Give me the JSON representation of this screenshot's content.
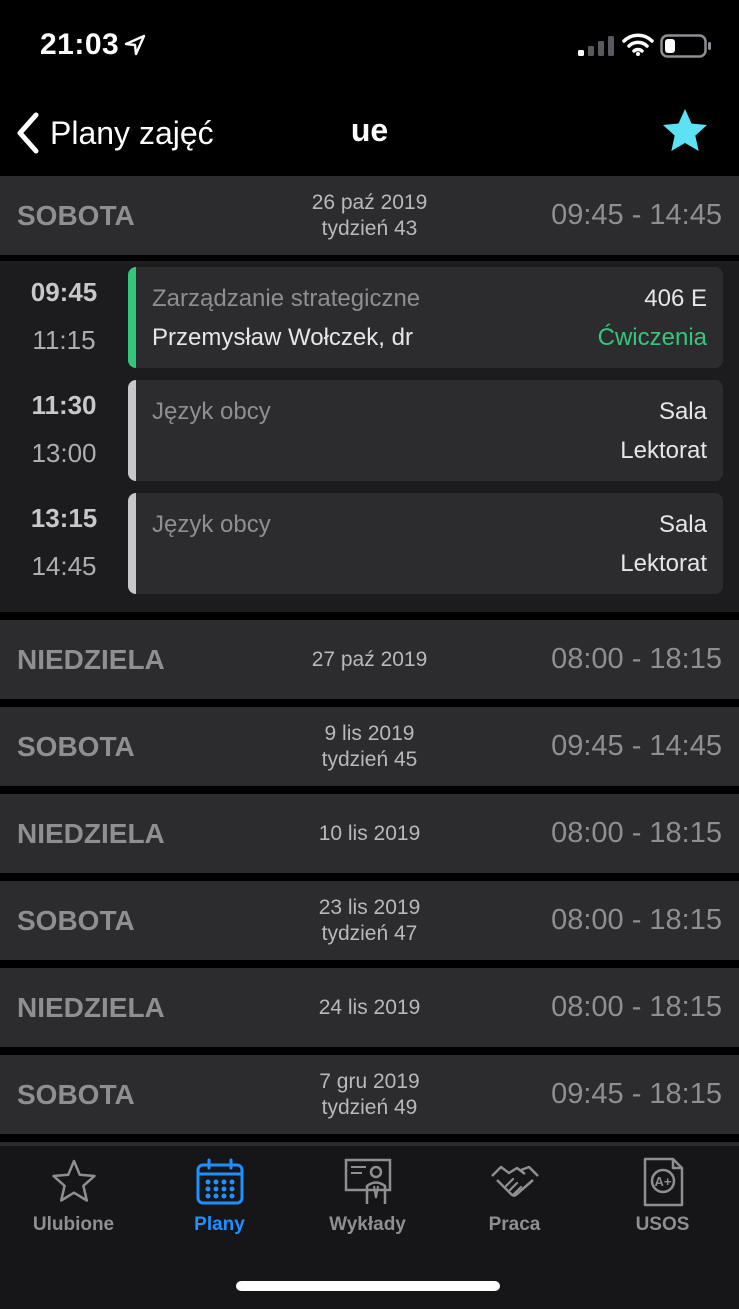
{
  "status_bar": {
    "time": "21:03",
    "icons": [
      "location-arrow-icon",
      "cellular-signal-icon",
      "wifi-icon",
      "battery-icon"
    ]
  },
  "nav": {
    "back_label": "Plany zajęć",
    "title": "ue",
    "favorite_icon": "star-filled-icon",
    "favorite_color": "#5ce1f5"
  },
  "days": [
    {
      "name": "SOBOTA",
      "date": "26 paź 2019",
      "week": "tydzień 43",
      "hours": "09:45 - 14:45",
      "lessons": [
        {
          "start": "09:45",
          "end": "11:15",
          "subject": "Zarządzanie strategiczne",
          "teacher": "Przemysław Wołczek, dr",
          "room": "406 E",
          "type": "Ćwiczenia",
          "type_color": "#34c77b",
          "bar_color": "#34c77b"
        },
        {
          "start": "11:30",
          "end": "13:00",
          "subject": "Język obcy",
          "teacher": "",
          "room": "Sala",
          "type": "Lektorat",
          "type_color": "#e5e5ea",
          "bar_color": "#c7c7cc"
        },
        {
          "start": "13:15",
          "end": "14:45",
          "subject": "Język obcy",
          "teacher": "",
          "room": "Sala",
          "type": "Lektorat",
          "type_color": "#e5e5ea",
          "bar_color": "#c7c7cc"
        }
      ]
    },
    {
      "name": "NIEDZIELA",
      "date": "27 paź 2019",
      "week": "",
      "hours": "08:00 - 18:15",
      "lessons": []
    },
    {
      "name": "SOBOTA",
      "date": "9 lis 2019",
      "week": "tydzień 45",
      "hours": "09:45 - 14:45",
      "lessons": []
    },
    {
      "name": "NIEDZIELA",
      "date": "10 lis 2019",
      "week": "",
      "hours": "08:00 - 18:15",
      "lessons": []
    },
    {
      "name": "SOBOTA",
      "date": "23 lis 2019",
      "week": "tydzień 47",
      "hours": "08:00 - 18:15",
      "lessons": []
    },
    {
      "name": "NIEDZIELA",
      "date": "24 lis 2019",
      "week": "",
      "hours": "08:00 - 18:15",
      "lessons": []
    },
    {
      "name": "SOBOTA",
      "date": "7 gru 2019",
      "week": "tydzień 49",
      "hours": "09:45 - 18:15",
      "lessons": []
    },
    {
      "name": "",
      "date": "",
      "week": "",
      "hours": "",
      "lessons": []
    }
  ],
  "tabs": [
    {
      "label": "Ulubione",
      "icon": "star-outline-icon",
      "active": false
    },
    {
      "label": "Plany",
      "icon": "calendar-icon",
      "active": true
    },
    {
      "label": "Wykłady",
      "icon": "lecturer-board-icon",
      "active": false
    },
    {
      "label": "Praca",
      "icon": "handshake-icon",
      "active": false
    },
    {
      "label": "USOS",
      "icon": "grade-document-icon",
      "active": false
    }
  ],
  "colors": {
    "accent_blue": "#1e90ff",
    "green": "#34c77b",
    "star_cyan": "#5ce1f5"
  }
}
